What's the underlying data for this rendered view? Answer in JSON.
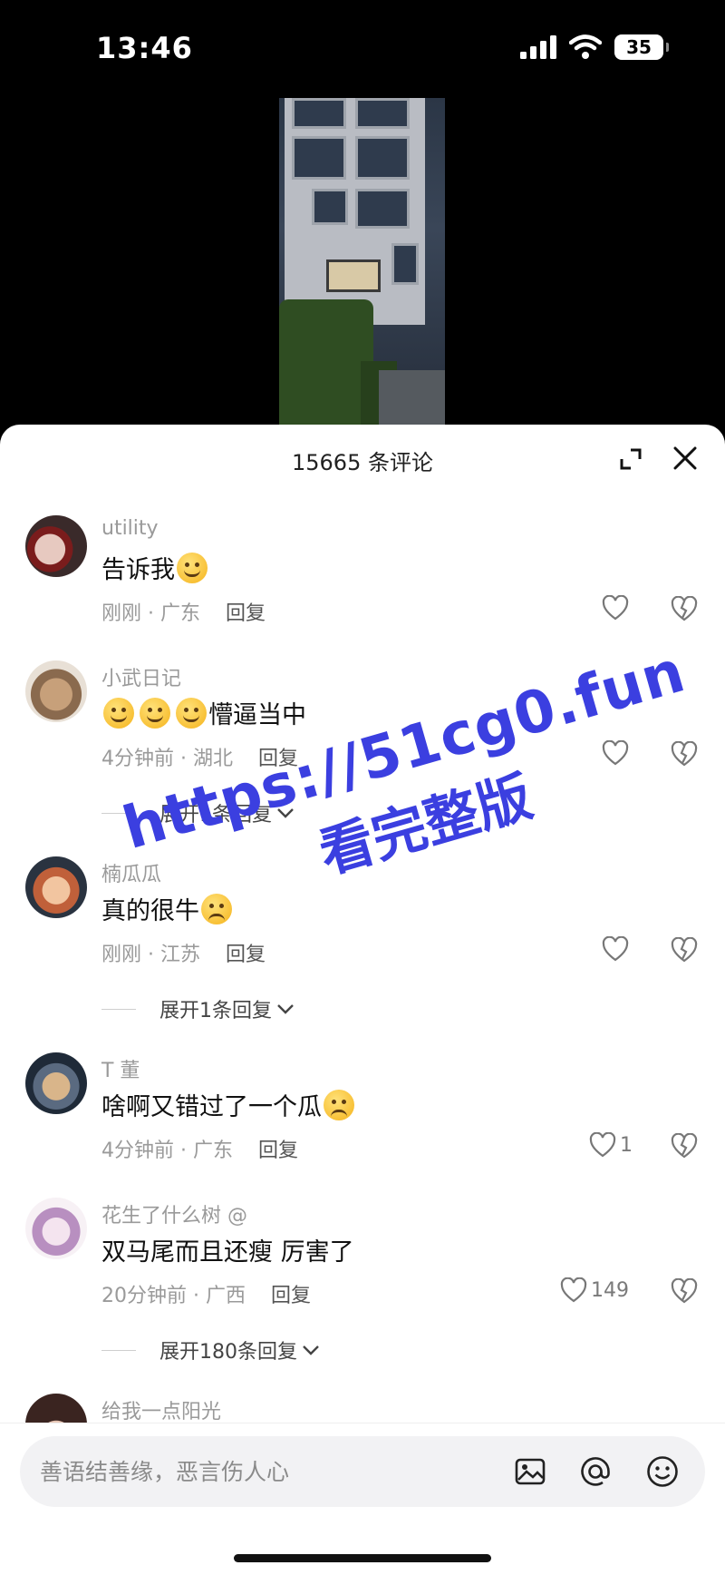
{
  "status": {
    "time": "13:46",
    "battery": "35"
  },
  "sheet": {
    "title": "15665 条评论"
  },
  "comments": [
    {
      "user": "utility",
      "text": "告诉我",
      "emojis": 1,
      "time": "刚刚 · 广东",
      "reply": "回复",
      "likes": ""
    },
    {
      "user": "小武日记",
      "text": "懵逼当中",
      "emojis_before": 3,
      "time": "4分钟前 · 湖北",
      "reply": "回复",
      "likes": "",
      "expand": "展开1条回复"
    },
    {
      "user": "楠瓜瓜",
      "text": "真的很牛",
      "emojis": 1,
      "time": "刚刚 · 江苏",
      "reply": "回复",
      "likes": "",
      "expand": "展开1条回复"
    },
    {
      "user": "T 董",
      "text": "啥啊又错过了一个瓜",
      "emojis": 1,
      "time": "4分钟前 · 广东",
      "reply": "回复",
      "likes": "1"
    },
    {
      "user": "花生了什么树 @",
      "text": "双马尾而且还瘦 厉害了",
      "time": "20分钟前 · 广西",
      "reply": "回复",
      "likes": "149",
      "expand": "展开180条回复"
    },
    {
      "user": "给我一点阳光"
    }
  ],
  "watermark": {
    "line1": "https://51cg0.fun",
    "line2": "看完整版"
  },
  "input": {
    "placeholder": "善语结善缘，恶言伤人心"
  },
  "colors": {
    "accent": "#3b3fe0",
    "text": "#111111",
    "muted": "#9a9a9a"
  }
}
